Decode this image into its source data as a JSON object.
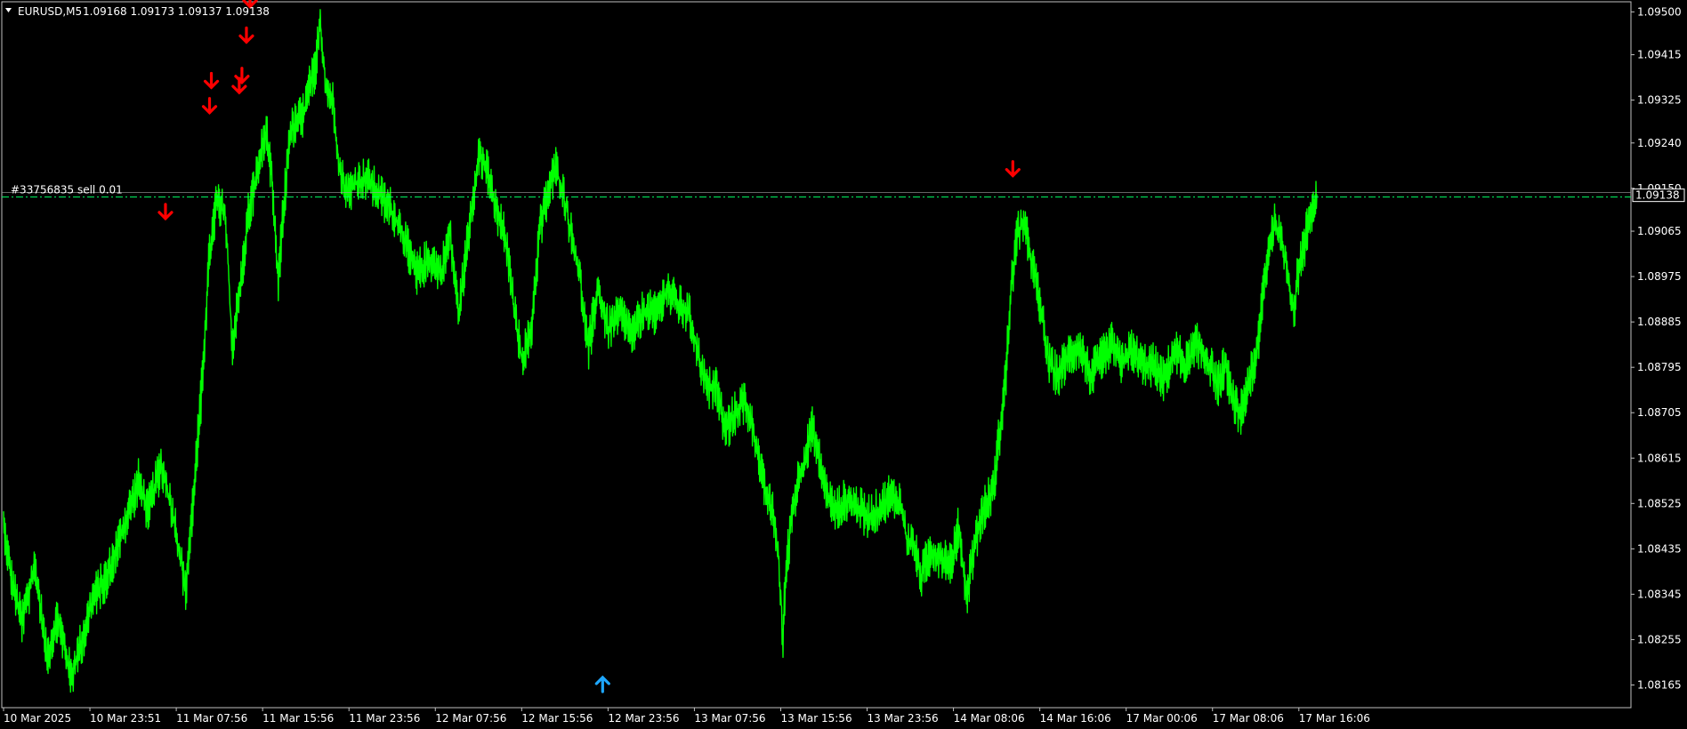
{
  "header": {
    "symbol_timeframe": "EURUSD,M5",
    "ohlc": "1.09168 1.09173 1.09137 1.09138",
    "dropdown_icon": "triangle-down-icon"
  },
  "order_line": {
    "label": "#33756835 sell 0.01",
    "price": 1.09138
  },
  "colors": {
    "background": "#000000",
    "price_line": "#00ff00",
    "axis_text": "#ffffff",
    "sell_arrow": "#ff0000",
    "buy_arrow": "#1ea7ff",
    "order_line": "#00ff66",
    "frame": "#c0c0c0"
  },
  "chart_data": {
    "type": "line",
    "symbol": "EURUSD",
    "timeframe": "M5",
    "ylim": [
      1.0812,
      1.0952
    ],
    "y_ticks": [
      "1.09500",
      "1.09415",
      "1.09325",
      "1.09240",
      "1.09150",
      "1.09065",
      "1.08975",
      "1.08885",
      "1.08795",
      "1.08705",
      "1.08615",
      "1.08525",
      "1.08435",
      "1.08345",
      "1.08255",
      "1.08165"
    ],
    "x_ticks": [
      "10 Mar 2025",
      "10 Mar 23:51",
      "11 Mar 07:56",
      "11 Mar 15:56",
      "11 Mar 23:56",
      "12 Mar 07:56",
      "12 Mar 15:56",
      "12 Mar 23:56",
      "13 Mar 07:56",
      "13 Mar 15:56",
      "13 Mar 23:56",
      "14 Mar 08:06",
      "14 Mar 16:06",
      "17 Mar 00:06",
      "17 Mar 08:06",
      "17 Mar 16:06"
    ],
    "x_tick_index": [
      0,
      96,
      192,
      288,
      384,
      480,
      576,
      672,
      768,
      864,
      960,
      1056,
      1152,
      1248,
      1344,
      1440
    ],
    "n_bars": 1460,
    "current_price_label": "1.09138",
    "series": [
      {
        "values_keypoints": [
          [
            0,
            1.0848
          ],
          [
            8,
            1.0838
          ],
          [
            20,
            1.0829
          ],
          [
            35,
            1.084
          ],
          [
            48,
            1.0822
          ],
          [
            60,
            1.083
          ],
          [
            75,
            1.0818
          ],
          [
            88,
            1.0826
          ],
          [
            100,
            1.0834
          ],
          [
            115,
            1.0838
          ],
          [
            130,
            1.0846
          ],
          [
            150,
            1.0857
          ],
          [
            160,
            1.0851
          ],
          [
            175,
            1.086
          ],
          [
            190,
            1.0849
          ],
          [
            202,
            1.0835
          ],
          [
            210,
            1.0852
          ],
          [
            220,
            1.0875
          ],
          [
            228,
            1.09
          ],
          [
            236,
            1.0912
          ],
          [
            246,
            1.091
          ],
          [
            254,
            1.0884
          ],
          [
            263,
            1.0895
          ],
          [
            272,
            1.091
          ],
          [
            282,
            1.0918
          ],
          [
            292,
            1.0927
          ],
          [
            298,
            1.0916
          ],
          [
            305,
            1.0897
          ],
          [
            318,
            1.0926
          ],
          [
            326,
            1.0928
          ],
          [
            334,
            1.093
          ],
          [
            340,
            1.0935
          ],
          [
            346,
            1.0938
          ],
          [
            352,
            1.0948
          ],
          [
            358,
            1.0935
          ],
          [
            366,
            1.0932
          ],
          [
            374,
            1.0918
          ],
          [
            382,
            1.0914
          ],
          [
            392,
            1.0916
          ],
          [
            404,
            1.0917
          ],
          [
            416,
            1.0914
          ],
          [
            430,
            1.0911
          ],
          [
            444,
            1.0906
          ],
          [
            458,
            1.0898
          ],
          [
            468,
            1.09
          ],
          [
            476,
            1.0901
          ],
          [
            486,
            1.0898
          ],
          [
            496,
            1.0906
          ],
          [
            506,
            1.089
          ],
          [
            518,
            1.0908
          ],
          [
            528,
            1.0922
          ],
          [
            538,
            1.0918
          ],
          [
            548,
            1.091
          ],
          [
            558,
            1.0905
          ],
          [
            566,
            1.0893
          ],
          [
            576,
            1.0881
          ],
          [
            586,
            1.0886
          ],
          [
            596,
            1.0907
          ],
          [
            606,
            1.0915
          ],
          [
            614,
            1.0919
          ],
          [
            622,
            1.0914
          ],
          [
            632,
            1.0905
          ],
          [
            640,
            1.0898
          ],
          [
            650,
            1.0883
          ],
          [
            660,
            1.0895
          ],
          [
            672,
            1.0887
          ],
          [
            686,
            1.089
          ],
          [
            700,
            1.0886
          ],
          [
            712,
            1.0891
          ],
          [
            724,
            1.089
          ],
          [
            738,
            1.0895
          ],
          [
            748,
            1.0892
          ],
          [
            762,
            1.089
          ],
          [
            772,
            1.0882
          ],
          [
            782,
            1.0875
          ],
          [
            792,
            1.0876
          ],
          [
            802,
            1.0867
          ],
          [
            812,
            1.087
          ],
          [
            824,
            1.0873
          ],
          [
            836,
            1.0865
          ],
          [
            846,
            1.0855
          ],
          [
            856,
            1.085
          ],
          [
            862,
            1.084
          ],
          [
            866,
            1.0825
          ],
          [
            870,
            1.084
          ],
          [
            876,
            1.085
          ],
          [
            884,
            1.0858
          ],
          [
            892,
            1.0862
          ],
          [
            898,
            1.0868
          ],
          [
            906,
            1.0862
          ],
          [
            914,
            1.0855
          ],
          [
            924,
            1.0851
          ],
          [
            936,
            1.0853
          ],
          [
            948,
            1.0852
          ],
          [
            960,
            1.085
          ],
          [
            972,
            1.0851
          ],
          [
            984,
            1.0854
          ],
          [
            996,
            1.0853
          ],
          [
            1004,
            1.0845
          ],
          [
            1012,
            1.0844
          ],
          [
            1020,
            1.0838
          ],
          [
            1030,
            1.0843
          ],
          [
            1042,
            1.0842
          ],
          [
            1054,
            1.0841
          ],
          [
            1062,
            1.0848
          ],
          [
            1070,
            1.0834
          ],
          [
            1078,
            1.0843
          ],
          [
            1088,
            1.0851
          ],
          [
            1100,
            1.0855
          ],
          [
            1108,
            1.0868
          ],
          [
            1114,
            1.0878
          ],
          [
            1120,
            1.0895
          ],
          [
            1126,
            1.0905
          ],
          [
            1132,
            1.0908
          ],
          [
            1138,
            1.0905
          ],
          [
            1146,
            1.0898
          ],
          [
            1154,
            1.089
          ],
          [
            1162,
            1.088
          ],
          [
            1172,
            1.0878
          ],
          [
            1184,
            1.0882
          ],
          [
            1196,
            1.0884
          ],
          [
            1208,
            1.0878
          ],
          [
            1220,
            1.0881
          ],
          [
            1232,
            1.0884
          ],
          [
            1242,
            1.088
          ],
          [
            1254,
            1.0883
          ],
          [
            1266,
            1.088
          ],
          [
            1278,
            1.088
          ],
          [
            1290,
            1.0877
          ],
          [
            1302,
            1.0883
          ],
          [
            1314,
            1.088
          ],
          [
            1326,
            1.0884
          ],
          [
            1338,
            1.0881
          ],
          [
            1350,
            1.0876
          ],
          [
            1358,
            1.088
          ],
          [
            1366,
            1.0873
          ],
          [
            1374,
            1.087
          ],
          [
            1384,
            1.0877
          ],
          [
            1392,
            1.088
          ],
          [
            1400,
            1.0895
          ],
          [
            1408,
            1.0905
          ],
          [
            1414,
            1.0908
          ],
          [
            1420,
            1.0904
          ],
          [
            1428,
            1.0898
          ],
          [
            1434,
            1.089
          ],
          [
            1440,
            1.09
          ],
          [
            1446,
            1.0904
          ],
          [
            1452,
            1.091
          ],
          [
            1460,
            1.09138
          ]
        ]
      }
    ],
    "sell_arrows": [
      {
        "bar": 180,
        "price": 1.0909
      },
      {
        "bar": 231,
        "price": 1.0935
      },
      {
        "bar": 229,
        "price": 1.093
      },
      {
        "bar": 265,
        "price": 1.0936
      },
      {
        "bar": 262,
        "price": 1.0934
      },
      {
        "bar": 270,
        "price": 1.0944
      },
      {
        "bar": 274,
        "price": 1.0951
      },
      {
        "bar": 1122,
        "price": 1.09175
      }
    ],
    "buy_arrows": [
      {
        "bar": 666,
        "price": 1.0818
      }
    ]
  }
}
